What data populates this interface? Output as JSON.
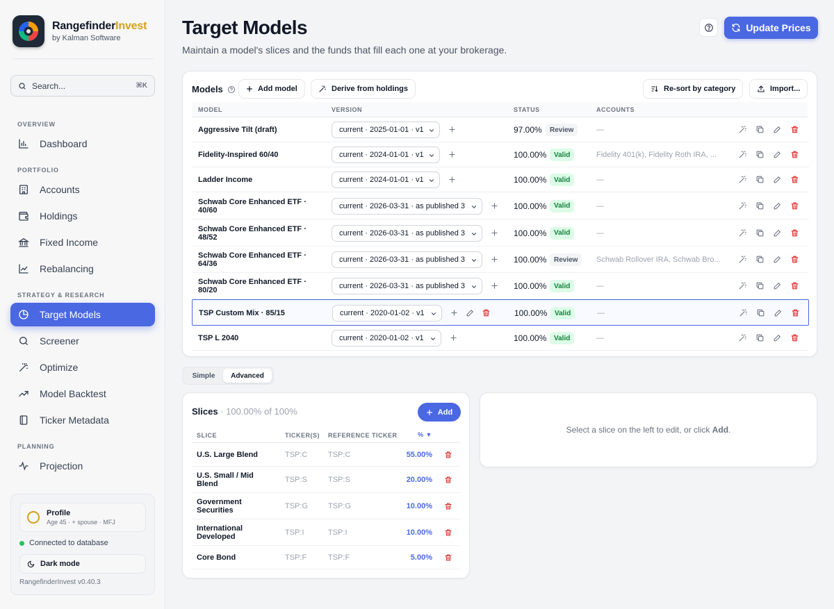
{
  "brand": {
    "name_main": "Rangefinder",
    "name_accent": "Invest",
    "sub": "by Kalman Software"
  },
  "search": {
    "placeholder": "Search...",
    "shortcut": "⌘K"
  },
  "nav": {
    "sections": [
      "OVERVIEW",
      "PORTFOLIO",
      "STRATEGY & RESEARCH",
      "PLANNING"
    ],
    "items": [
      {
        "label": "Dashboard",
        "icon": "bar-chart-icon"
      },
      {
        "label": "Accounts",
        "icon": "building-icon"
      },
      {
        "label": "Holdings",
        "icon": "wallet-icon"
      },
      {
        "label": "Fixed Income",
        "icon": "landmark-icon"
      },
      {
        "label": "Rebalancing",
        "icon": "line-chart-icon"
      },
      {
        "label": "Target Models",
        "icon": "pie-chart-icon",
        "active": true
      },
      {
        "label": "Screener",
        "icon": "search-icon"
      },
      {
        "label": "Optimize",
        "icon": "wand-icon"
      },
      {
        "label": "Model Backtest",
        "icon": "trend-icon"
      },
      {
        "label": "Ticker Metadata",
        "icon": "book-icon"
      },
      {
        "label": "Projection",
        "icon": "activity-icon"
      }
    ]
  },
  "footer": {
    "profile_name": "Profile",
    "profile_sub": "Age 45 · + spouse · MFJ",
    "connection": "Connected to database",
    "dark_mode": "Dark mode",
    "version": "RangefinderInvest v0.40.3"
  },
  "header": {
    "title": "Target Models",
    "subtitle": "Maintain a model's slices and the funds that fill each one at your brokerage.",
    "update_label": "Update Prices"
  },
  "models": {
    "label": "Models",
    "add_model": "Add model",
    "derive": "Derive from holdings",
    "resort": "Re-sort by category",
    "import": "Import...",
    "columns": [
      "MODEL",
      "VERSION",
      "STATUS",
      "ACCOUNTS"
    ],
    "rows": [
      {
        "name": "Aggressive Tilt (draft)",
        "version": "current · 2025-01-01 · v1",
        "pct": "97.00%",
        "status": "Review",
        "accounts": "—"
      },
      {
        "name": "Fidelity-Inspired 60/40",
        "version": "current · 2024-01-01 · v1",
        "pct": "100.00%",
        "status": "Valid",
        "accounts": "Fidelity 401(k), Fidelity Roth IRA, ..."
      },
      {
        "name": "Ladder Income",
        "version": "current · 2024-01-01 · v1",
        "pct": "100.00%",
        "status": "Valid",
        "accounts": "—"
      },
      {
        "name": "Schwab Core Enhanced ETF · 40/60",
        "version": "current · 2026-03-31 · as published 3",
        "pct": "100.00%",
        "status": "Valid",
        "accounts": "—"
      },
      {
        "name": "Schwab Core Enhanced ETF · 48/52",
        "version": "current · 2026-03-31 · as published 3",
        "pct": "100.00%",
        "status": "Valid",
        "accounts": "—"
      },
      {
        "name": "Schwab Core Enhanced ETF · 64/36",
        "version": "current · 2026-03-31 · as published 3",
        "pct": "100.00%",
        "status": "Review",
        "accounts": "Schwab Rollover IRA, Schwab Bro..."
      },
      {
        "name": "Schwab Core Enhanced ETF · 80/20",
        "version": "current · 2026-03-31 · as published 3",
        "pct": "100.00%",
        "status": "Valid",
        "accounts": "—"
      },
      {
        "name": "TSP Custom Mix · 85/15",
        "version": "current · 2020-01-02 · v1",
        "pct": "100.00%",
        "status": "Valid",
        "accounts": "—"
      },
      {
        "name": "TSP L 2040",
        "version": "current · 2020-01-02 · v1",
        "pct": "100.00%",
        "status": "Valid",
        "accounts": "—"
      }
    ]
  },
  "mode_toggle": {
    "simple": "Simple",
    "advanced": "Advanced"
  },
  "slices": {
    "title": "Slices",
    "summary": " · 100.00% of 100%",
    "add": "Add",
    "columns": [
      "SLICE",
      "TICKER(S)",
      "REFERENCE TICKER",
      "% ▼"
    ],
    "rows": [
      {
        "name": "U.S. Large Blend",
        "ticker": "TSP:C",
        "ref": "TSP:C",
        "pct": "55.00%"
      },
      {
        "name": "U.S. Small / Mid Blend",
        "ticker": "TSP:S",
        "ref": "TSP:S",
        "pct": "20.00%"
      },
      {
        "name": "Government Securities",
        "ticker": "TSP:G",
        "ref": "TSP:G",
        "pct": "10.00%"
      },
      {
        "name": "International Developed",
        "ticker": "TSP:I",
        "ref": "TSP:I",
        "pct": "10.00%"
      },
      {
        "name": "Core Bond",
        "ticker": "TSP:F",
        "ref": "TSP:F",
        "pct": "5.00%"
      }
    ]
  },
  "detail": {
    "msg_before": "Select a slice on the left to edit, or click ",
    "msg_bold": "Add",
    "msg_after": "."
  },
  "colors": {
    "accent": "#4a68e2",
    "brand_gold": "#d4a017",
    "valid_bg": "#dcfce7",
    "valid_fg": "#15803d",
    "danger": "#dc2626"
  }
}
